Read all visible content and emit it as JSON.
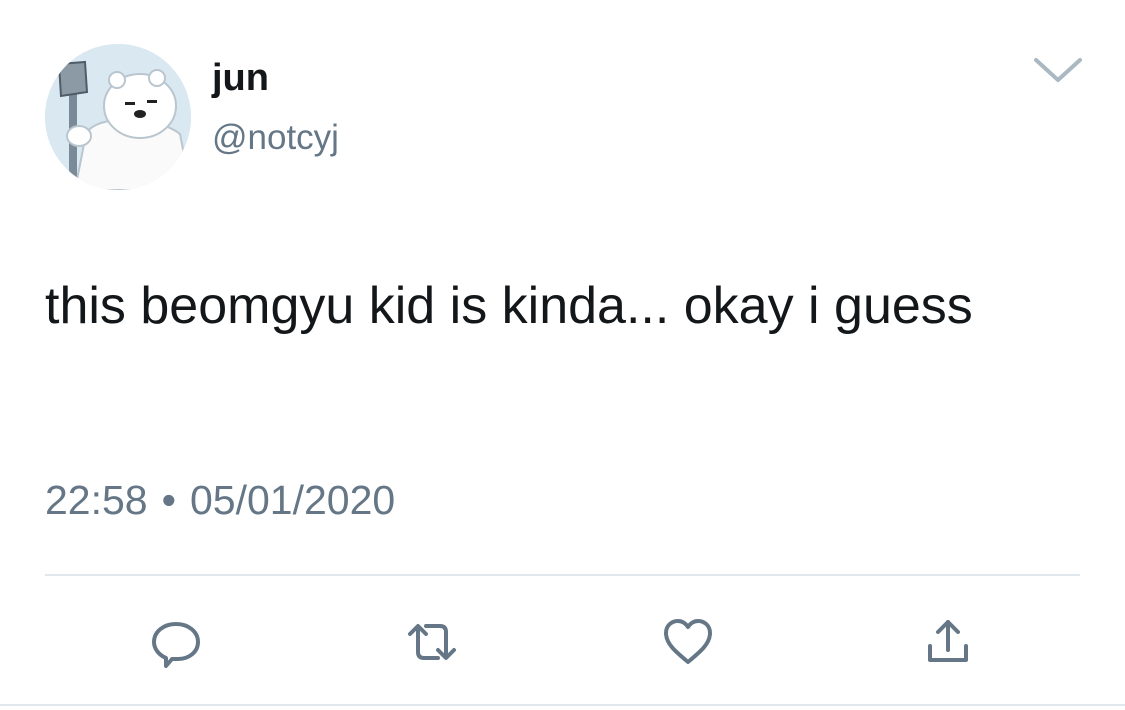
{
  "tweet": {
    "author": {
      "display_name": "jun",
      "handle": "@notcyj",
      "avatar_icon": "polar-bear-with-axe-avatar"
    },
    "text": "this beomgyu kid is kinda... okay i guess",
    "time": "22:58",
    "separator": "•",
    "date": "05/01/2020",
    "menu_icon": "chevron-down-icon"
  },
  "actions": [
    {
      "name": "reply",
      "icon": "reply-icon"
    },
    {
      "name": "retweet",
      "icon": "retweet-icon"
    },
    {
      "name": "like",
      "icon": "heart-icon"
    },
    {
      "name": "share",
      "icon": "share-icon"
    }
  ],
  "colors": {
    "text": "#14171a",
    "secondary": "#657786",
    "icon": "#657786",
    "divider": "#e1e8ed"
  }
}
